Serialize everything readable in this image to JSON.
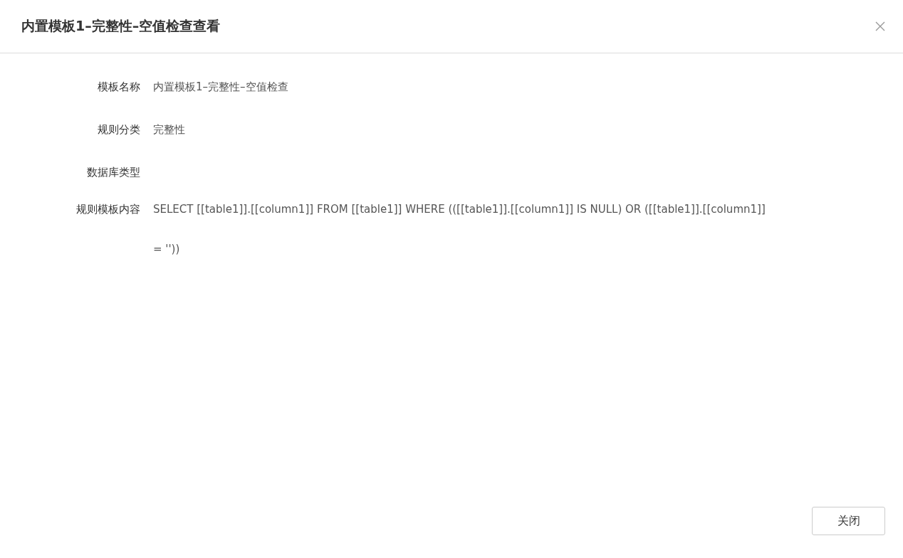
{
  "dialog": {
    "title": "内置模板1–完整性–空值检查查看",
    "fields": [
      {
        "label": "模板名称",
        "value": "内置模板1–完整性–空值检查"
      },
      {
        "label": "规则分类",
        "value": "完整性"
      },
      {
        "label": "数据库类型"
      },
      {
        "label": "规则模板内容",
        "value": "SELECT [[table1]].[[column1]] FROM [[table1]] WHERE (([[table1]].[[column1]] IS NULL) OR ([[table1]].[[column1]] = ''))"
      }
    ],
    "buttons": [
      "关闭"
    ]
  }
}
